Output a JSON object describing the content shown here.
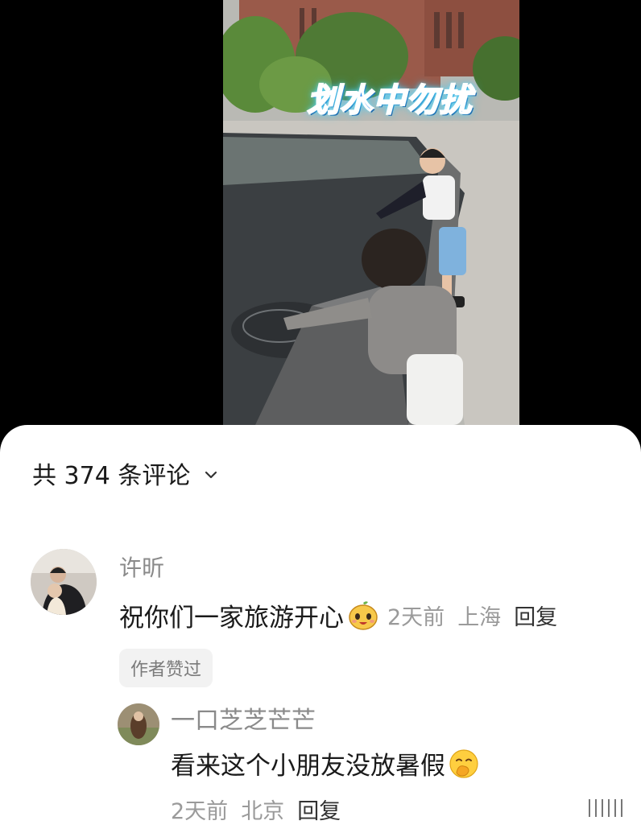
{
  "video": {
    "caption": "划水中勿扰"
  },
  "comments_header": {
    "count_label": "共 374 条评论",
    "chevron_icon": "chevron-down-icon"
  },
  "comments": [
    {
      "author": "许昕",
      "text": "祝你们一家旅游开心",
      "emoji_icon": "mango-face-icon",
      "time": "2天前",
      "location": "上海",
      "reply_label": "回复",
      "badge": "作者赞过"
    },
    {
      "author": "一口芝芝芒芒",
      "text": "看来这个小朋友没放暑假",
      "emoji_icon": "hand-over-mouth-smile-icon",
      "time": "2天前",
      "location": "北京",
      "reply_label": "回复"
    }
  ],
  "colors": {
    "caption_fill": "#2a8cf0",
    "caption_glow": "#6fe4ff",
    "text_primary": "#1a1a1a",
    "text_secondary": "#9a9a9a",
    "badge_bg": "#f2f2f2",
    "sheet_bg": "#ffffff"
  }
}
